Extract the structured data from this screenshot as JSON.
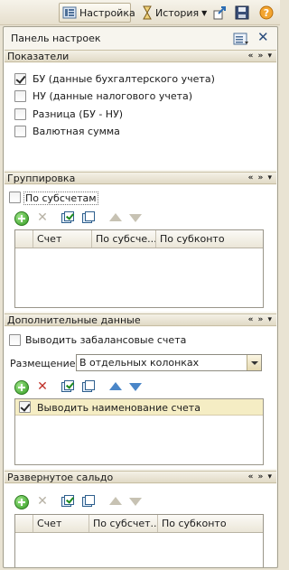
{
  "toolbar": {
    "settings_label": "Настройка",
    "history_label": "История",
    "icons": [
      "settings-icon",
      "history-icon",
      "export-icon",
      "save-icon",
      "help-icon"
    ]
  },
  "panel": {
    "title": "Панель настроек",
    "close_label": "✕"
  },
  "sections": {
    "indicators": {
      "title": "Показатели",
      "controls": "« » ▾",
      "items": [
        {
          "label": "БУ (данные бухгалтерского учета)",
          "checked": true
        },
        {
          "label": "НУ (данные налогового учета)",
          "checked": false
        },
        {
          "label": "Разница (БУ - НУ)",
          "checked": false
        },
        {
          "label": "Валютная сумма",
          "checked": false
        }
      ]
    },
    "grouping": {
      "title": "Группировка",
      "controls": "« » ▾",
      "by_subaccounts_label": "По субсчетам",
      "table_columns": [
        "Счет",
        "По субсче...",
        "По субконто"
      ]
    },
    "additional": {
      "title": "Дополнительные данные",
      "controls": "« » ▾",
      "offbalance_label": "Выводить забалансовые счета",
      "placement_label": "Размещение:",
      "placement_value": "В отдельных колонках",
      "list_item_label": "Выводить наименование счета"
    },
    "expanded": {
      "title": "Развернутое сальдо",
      "controls": "« » ▾",
      "table_columns": [
        "Счет",
        "По субсчет...",
        "По субконто"
      ]
    }
  }
}
